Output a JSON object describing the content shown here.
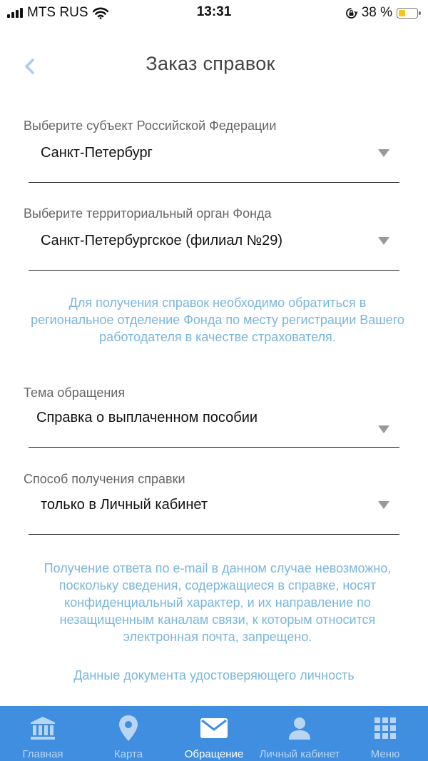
{
  "status_bar": {
    "carrier": "MTS RUS",
    "time": "13:31",
    "battery": "38 %",
    "battery_level": 0.38
  },
  "header": {
    "title": "Заказ справок",
    "back_icon": "chevron-left-icon"
  },
  "form": {
    "region": {
      "label": "Выберите субъект Российской Федерации",
      "value": "Санкт-Петербург"
    },
    "office": {
      "label": "Выберите территориальный орган Фонда",
      "value": "Санкт-Петербургское (филиал №29)"
    },
    "office_info": "Для получения справок необходимо обратиться в региональное отделение Фонда по месту регистрации Вашего работодателя в качестве страхователя.",
    "topic": {
      "label": "Тема обращения",
      "value": "Справка о выплаченном пособии"
    },
    "delivery": {
      "label": "Способ получения справки",
      "value": "только в Личный кабинет"
    },
    "delivery_info": "Получение ответа по e-mail в данном случае невозможно, поскольку сведения, содержащиеся в справке, носят конфиденциальный характер, и их направление по незащищенным каналам связи, к которым относится электронная почта, запрещено.",
    "id_section_title": "Данные документа удостоверяющего личность"
  },
  "nav": {
    "items": [
      {
        "label": "Главная",
        "icon": "bank-icon"
      },
      {
        "label": "Карта",
        "icon": "map-pin-icon"
      },
      {
        "label": "Обращение",
        "icon": "envelope-icon"
      },
      {
        "label": "Личный кабинет",
        "icon": "user-icon"
      },
      {
        "label": "Меню",
        "icon": "grid-icon"
      }
    ],
    "active_index": 2
  },
  "colors": {
    "accent": "#3f8ee0",
    "info_text": "#7ab6dc",
    "back_chevron": "#a9cdec",
    "nav_inactive": "#b9d5f4"
  }
}
